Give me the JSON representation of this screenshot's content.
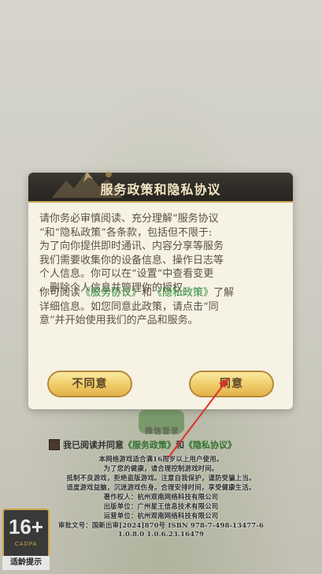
{
  "background": {
    "wechat_login_label": "微信登录",
    "agree_row": {
      "prefix": "我已阅读并同意",
      "service_link": "《服务政策》",
      "and": "和",
      "privacy_link": "《隐私协议》"
    },
    "notices": [
      "本网络游戏适合满16周岁以上用户使用。",
      "为了您的健康，请合理控制游戏时间。",
      "抵制不良游戏，拒绝盗版游戏。注意自我保护，谨防受骗上当。",
      "适度游戏益脑，沉迷游戏伤身。合理安排时间，享受健康生活。",
      "著作权人：杭州观南网络科技有限公司",
      "出版单位：广州星王信息技术有限公司",
      "运营单位：杭州观南网络科技有限公司",
      "审批文号：国新出审[2024]870号 ISBN 978-7-498-13477-6",
      "1.0.8.0    1.0.6.23.16479"
    ],
    "age_badge": {
      "number": "16+",
      "org": "CADPA",
      "tip": "适龄提示"
    }
  },
  "dialog": {
    "title": "服务政策和隐私协议",
    "para1_lines": [
      "请你务必审慎阅读、充分理解“服务协议",
      "“和“隐私政策“各条款，包括但不限于:",
      "为了向你提供即时通讯、内容分享等服务",
      "我们需要收集你的设备信息、操作日志等",
      "个人信息。你可以在“设置“中查看变更",
      "、删除个人信息并管理你的授权。"
    ],
    "para2": {
      "lead": "你可阅读",
      "service_link": "《服务协议》",
      "and": "和",
      "privacy_link": "《隐私政策》",
      "line1_end": "了解",
      "line2": "详细信息。如您同意此政策，请点击“同",
      "line3": "意”并开始使用我们的产品和服务。"
    },
    "disagree_label": "不同意",
    "agree_label": "同意"
  },
  "colors": {
    "link_green": "#2e8b3a",
    "header_dark": "#26231f",
    "button_gold": "#f0ce6c",
    "arrow_red": "#e0302a"
  }
}
